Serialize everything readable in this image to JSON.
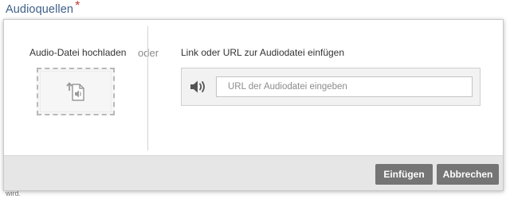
{
  "section": {
    "title": "Audioquellen",
    "required_marker": "*"
  },
  "upload": {
    "label": "Audio-Datei hochladen",
    "icon": "upload-audio-file-icon"
  },
  "separator": {
    "text": "oder"
  },
  "url": {
    "label": "Link oder URL zur Audiodatei einfügen",
    "icon": "speaker-icon",
    "placeholder": "URL der Audiodatei eingeben",
    "value": ""
  },
  "footer": {
    "insert_label": "Einfügen",
    "cancel_label": "Abbrechen"
  },
  "background_text": {
    "partial": "wird."
  },
  "colors": {
    "title": "#3e5f8a",
    "required": "#c0392b",
    "button": "#757575",
    "footer_bg": "#e6e6e6"
  }
}
